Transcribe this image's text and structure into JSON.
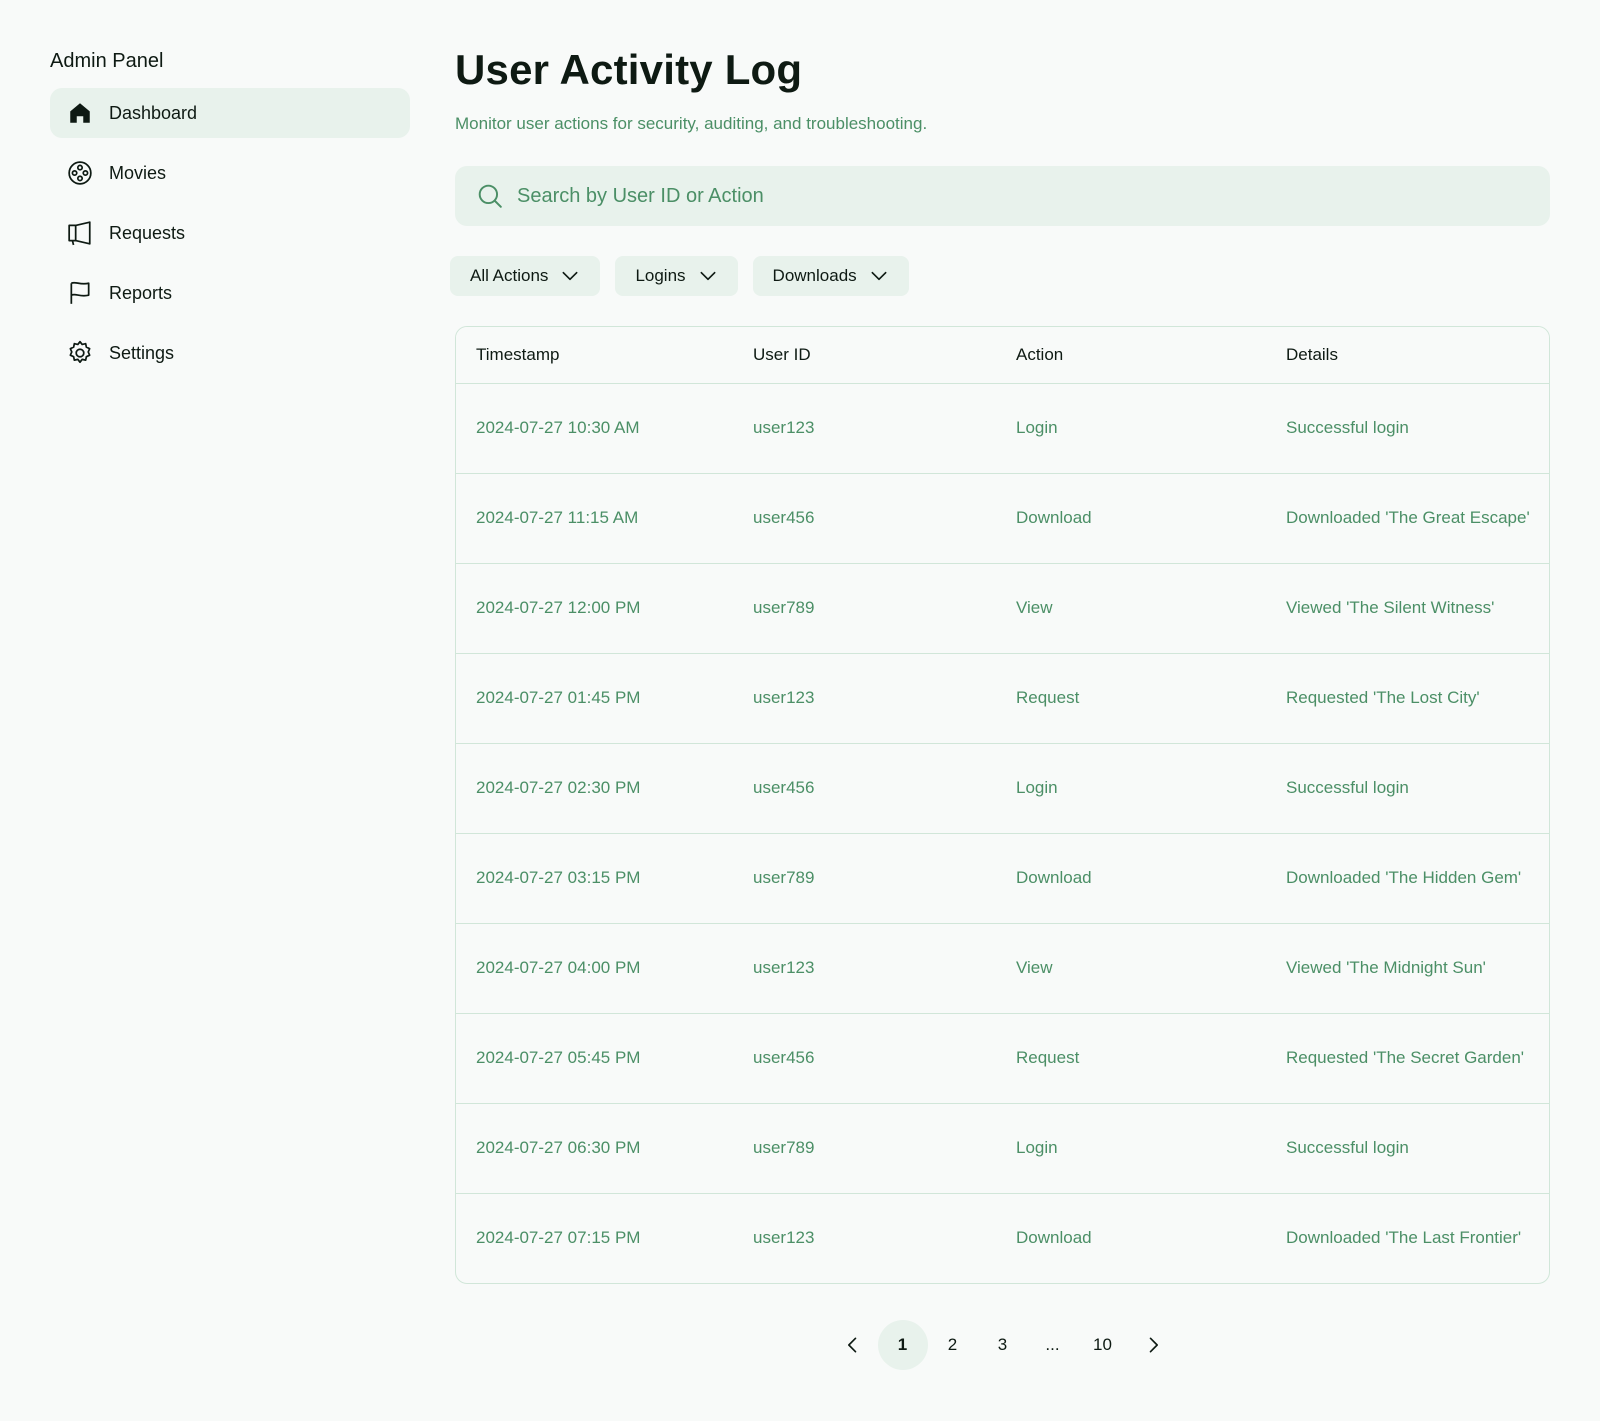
{
  "sidebar": {
    "title": "Admin Panel",
    "items": [
      {
        "label": "Dashboard",
        "icon": "house-icon",
        "active": true
      },
      {
        "label": "Movies",
        "icon": "film-reel-icon",
        "active": false
      },
      {
        "label": "Requests",
        "icon": "megaphone-icon",
        "active": false
      },
      {
        "label": "Reports",
        "icon": "flag-icon",
        "active": false
      },
      {
        "label": "Settings",
        "icon": "gear-icon",
        "active": false
      }
    ]
  },
  "header": {
    "title": "User Activity Log",
    "subtitle": "Monitor user actions for security, auditing, and troubleshooting."
  },
  "search": {
    "placeholder": "Search by User ID or Action",
    "value": ""
  },
  "filters": [
    {
      "label": "All Actions"
    },
    {
      "label": "Logins"
    },
    {
      "label": "Downloads"
    }
  ],
  "table": {
    "columns": [
      "Timestamp",
      "User ID",
      "Action",
      "Details"
    ],
    "rows": [
      [
        "2024-07-27 10:30 AM",
        "user123",
        "Login",
        "Successful login"
      ],
      [
        "2024-07-27 11:15 AM",
        "user456",
        "Download",
        "Downloaded 'The Great Escape'"
      ],
      [
        "2024-07-27 12:00 PM",
        "user789",
        "View",
        "Viewed 'The Silent Witness'"
      ],
      [
        "2024-07-27 01:45 PM",
        "user123",
        "Request",
        "Requested 'The Lost City'"
      ],
      [
        "2024-07-27 02:30 PM",
        "user456",
        "Login",
        "Successful login"
      ],
      [
        "2024-07-27 03:15 PM",
        "user789",
        "Download",
        "Downloaded 'The Hidden Gem'"
      ],
      [
        "2024-07-27 04:00 PM",
        "user123",
        "View",
        "Viewed 'The Midnight Sun'"
      ],
      [
        "2024-07-27 05:45 PM",
        "user456",
        "Request",
        "Requested 'The Secret Garden'"
      ],
      [
        "2024-07-27 06:30 PM",
        "user789",
        "Login",
        "Successful login"
      ],
      [
        "2024-07-27 07:15 PM",
        "user123",
        "Download",
        "Downloaded 'The Last Frontier'"
      ]
    ]
  },
  "pagination": {
    "pages": [
      "1",
      "2",
      "3",
      "...",
      "10"
    ],
    "current": "1"
  },
  "colors": {
    "background": "#f8faf9",
    "accent_bg": "#e8f2ec",
    "muted_text": "#4b8f66",
    "border": "#d1e6d9",
    "text": "#0e1a13"
  }
}
